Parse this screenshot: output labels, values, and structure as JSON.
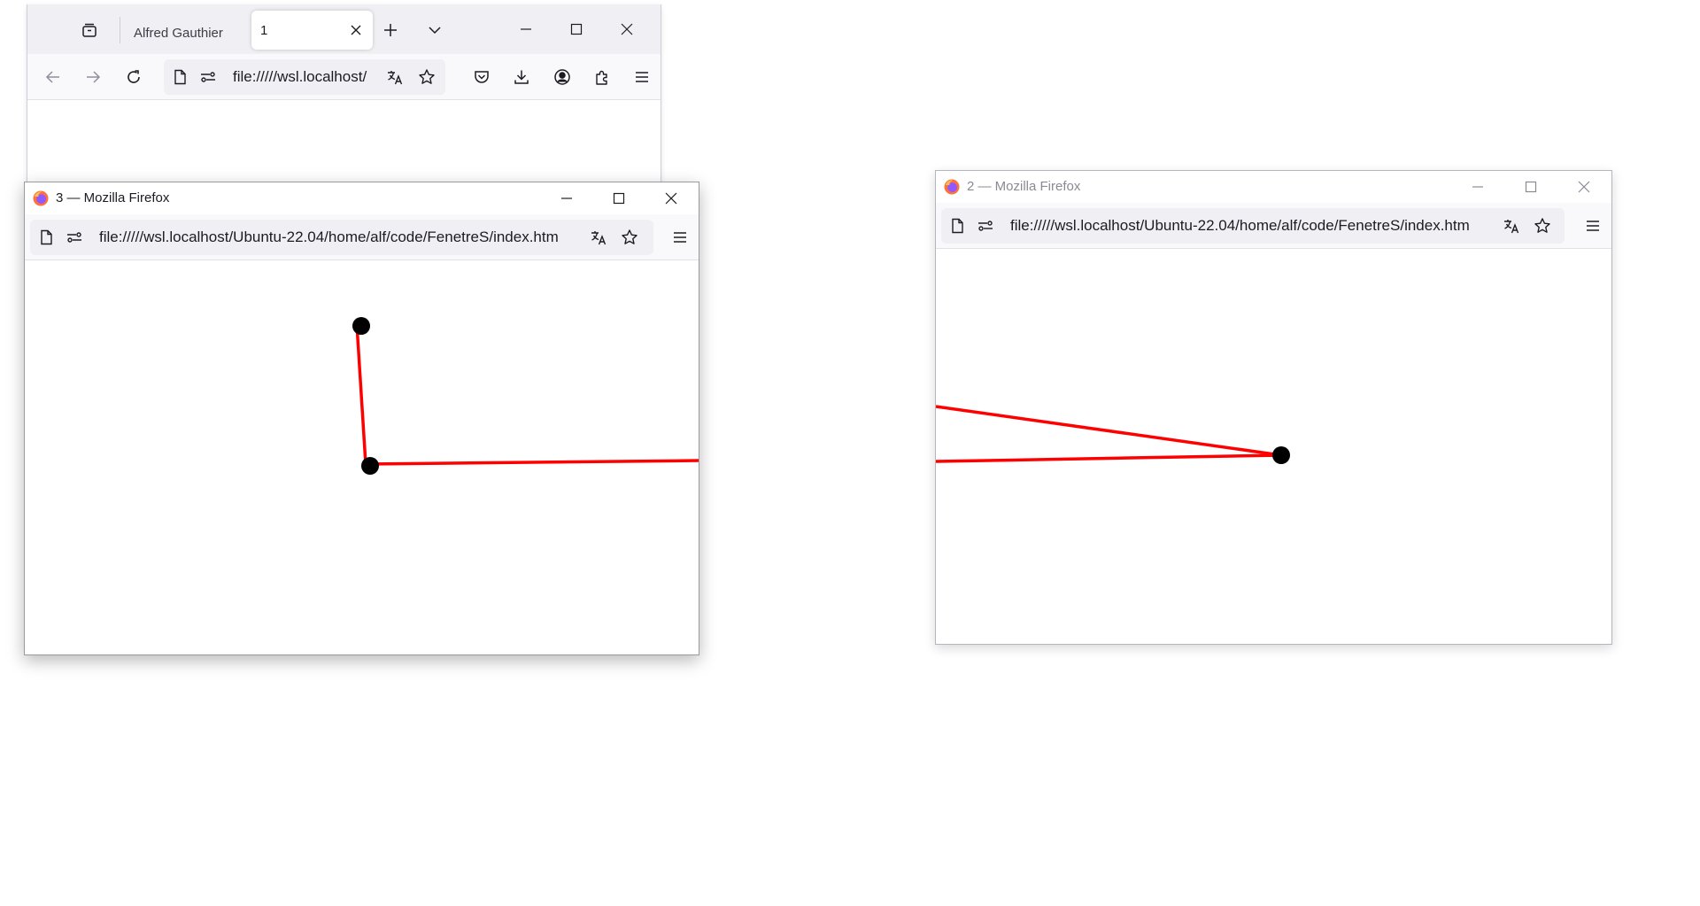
{
  "colors": {
    "line": "#ff0000",
    "point": "#000000"
  },
  "window1": {
    "tabs": [
      {
        "label": "Alfred Gauthier",
        "active": false
      },
      {
        "label": "1",
        "active": true
      }
    ],
    "url": "file://///wsl.localhost/",
    "icons": [
      "firefox-view-icon",
      "new-tab-icon",
      "list-all-tabs-icon",
      "back-icon",
      "forward-icon",
      "reload-icon",
      "page-icon",
      "permissions-icon",
      "translate-icon",
      "bookmark-star-icon",
      "pocket-icon",
      "downloads-icon",
      "account-icon",
      "extensions-icon",
      "menu-icon",
      "minimize-icon",
      "maximize-icon",
      "close-icon"
    ]
  },
  "window3": {
    "title": "3 — Mozilla Firefox",
    "url": "file://///wsl.localhost/Ubuntu-22.04/home/alf/code/FenetreS/index.htm",
    "icons": [
      "firefox-logo-icon",
      "page-icon",
      "permissions-icon",
      "translate-icon",
      "bookmark-star-icon",
      "menu-icon",
      "minimize-icon",
      "maximize-icon",
      "close-icon"
    ]
  },
  "window2": {
    "title": "2 — Mozilla Firefox",
    "url": "file://///wsl.localhost/Ubuntu-22.04/home/alf/code/FenetreS/index.htm",
    "icons": [
      "firefox-logo-icon",
      "page-icon",
      "permissions-icon",
      "translate-icon",
      "bookmark-star-icon",
      "menu-icon",
      "minimize-icon",
      "maximize-icon",
      "close-icon"
    ]
  }
}
